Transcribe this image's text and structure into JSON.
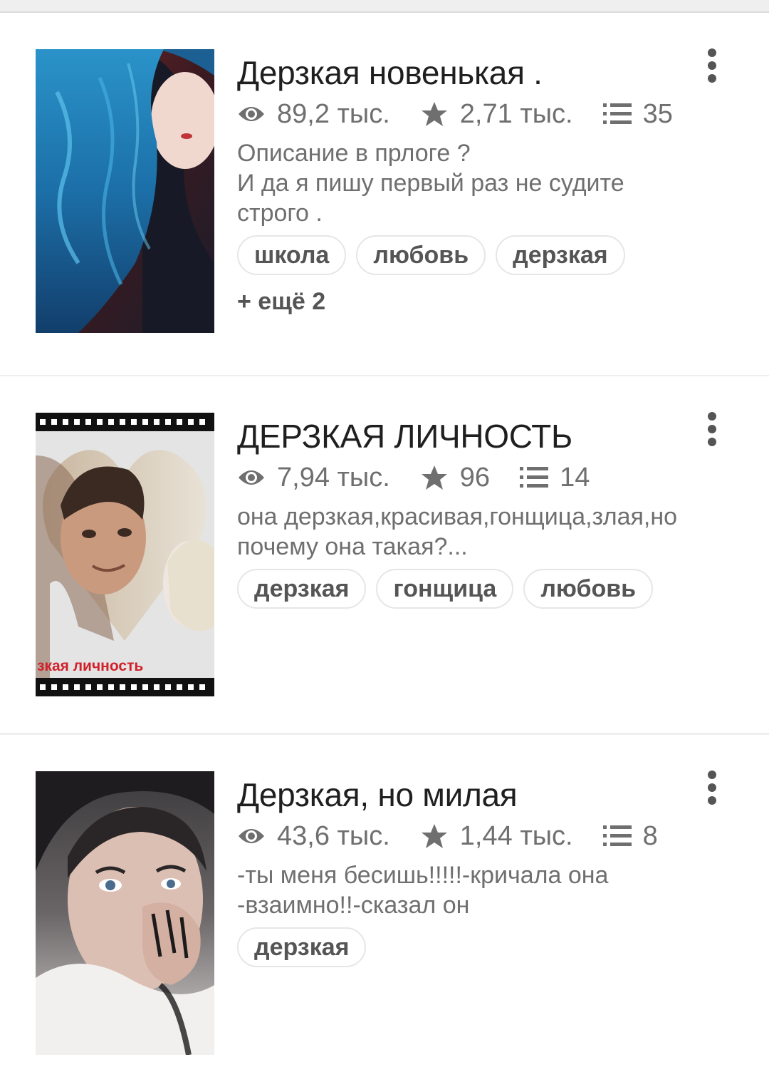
{
  "stories": [
    {
      "title": "Дерзкая новенькая .",
      "views": "89,2 тыс.",
      "votes": "2,71 тыс.",
      "parts": "35",
      "description": "Описание в прлоге ?\nИ да я пишу первый раз не судите строго .",
      "tags": [
        "школа",
        "любовь",
        "дерзкая"
      ],
      "more_tags": "+ ещё 2",
      "cover": "blue-hair-girl"
    },
    {
      "title": "ДЕРЗКАЯ ЛИЧНОСТЬ",
      "views": "7,94 тыс.",
      "votes": "96",
      "parts": "14",
      "description": "она дерзкая,красивая,гонщица,злая,но почему она такая?...",
      "tags": [
        "дерзкая",
        "гонщица",
        "любовь"
      ],
      "cover": "heart-film-couple",
      "cover_text": "зкая личность"
    },
    {
      "title": "Дерзкая, но милая",
      "views": "43,6 тыс.",
      "votes": "1,44 тыс.",
      "parts": "8",
      "description": "-ты меня бесишь!!!!!-кричала она\n-взаимно!!-сказал он",
      "tags": [
        "дерзкая"
      ],
      "cover": "girl-covering-mouth"
    }
  ],
  "icons": {
    "views": "eye-icon",
    "votes": "star-icon",
    "parts": "list-icon",
    "menu": "more-vertical-icon"
  },
  "colors": {
    "card_background": "#ffffff",
    "page_background": "#efefef",
    "meta_text": "#6f6f6f",
    "title_text": "#1f1f1f"
  }
}
